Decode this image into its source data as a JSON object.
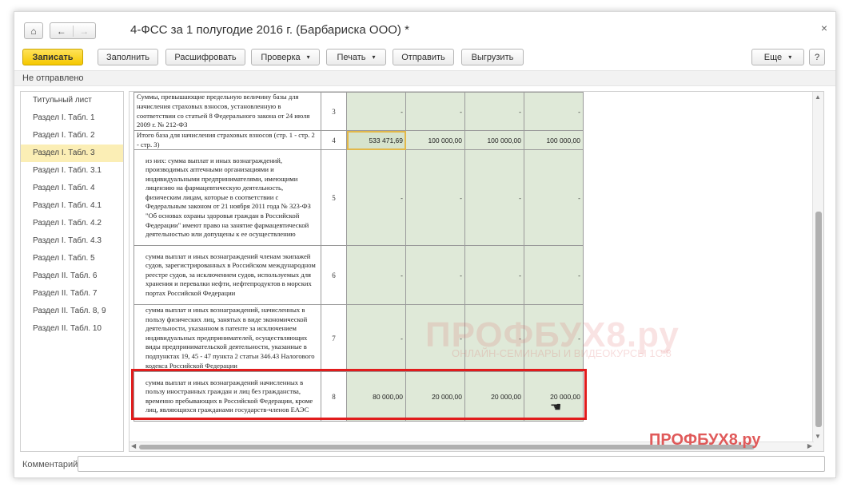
{
  "window": {
    "title": "4-ФСС за 1 полугодие 2016 г. (Барбариска ООО) *",
    "close_glyph": "×",
    "home_glyph": "⌂",
    "back_glyph": "←",
    "forward_glyph": "→"
  },
  "toolbar": {
    "save": "Записать",
    "fill": "Заполнить",
    "decode": "Расшифровать",
    "check": "Проверка",
    "print": "Печать",
    "send": "Отправить",
    "upload": "Выгрузить",
    "more": "Еще",
    "help": "?",
    "dropdown_glyph": "▾"
  },
  "status": "Не отправлено",
  "sidebar": {
    "items": [
      {
        "label": "Титульный лист"
      },
      {
        "label": "Раздел I. Табл. 1"
      },
      {
        "label": "Раздел I. Табл. 2"
      },
      {
        "label": "Раздел I. Табл. 3",
        "active": true
      },
      {
        "label": "Раздел I. Табл. 3.1"
      },
      {
        "label": "Раздел I. Табл. 4"
      },
      {
        "label": "Раздел I. Табл. 4.1"
      },
      {
        "label": "Раздел I. Табл. 4.2"
      },
      {
        "label": "Раздел I. Табл. 4.3"
      },
      {
        "label": "Раздел I. Табл. 5"
      },
      {
        "label": "Раздел II. Табл. 6"
      },
      {
        "label": "Раздел II. Табл. 7"
      },
      {
        "label": "Раздел II. Табл. 8, 9"
      },
      {
        "label": "Раздел II. Табл. 10"
      }
    ]
  },
  "table": {
    "rows": [
      {
        "desc": "Суммы, превышающие предельную величину базы для начисления страховых взносов, установленную в соответствии со статьей 8 Федерального закона от 24 июля 2009 г. № 212-ФЗ",
        "code": "3",
        "values": [
          "-",
          "-",
          "-",
          "-"
        ]
      },
      {
        "desc": "Итого база для начисления страховых взносов (стр. 1 - стр. 2 - стр. 3)",
        "code": "4",
        "values": [
          "533 471,69",
          "100 000,00",
          "100 000,00",
          "100 000,00"
        ]
      },
      {
        "desc": "из них: сумма выплат и иных вознаграждений, производимых аптечными организациями и индивидуальными предпринимателями, имеющими лицензию на фармацевтическую деятельность, физическим лицам, которые в соответствии с Федеральным законом от 21 ноября 2011 года № 323-ФЗ \"Об основах охраны здоровья граждан в Российской Федерации\" имеют право на занятие фармацевтической деятельностью или допущены к ее осуществлению",
        "code": "5",
        "values": [
          "-",
          "-",
          "-",
          "-"
        ]
      },
      {
        "desc": "сумма выплат и иных вознаграждений членам экипажей судов, зарегистрированных в Российском международном реестре судов, за исключением судов, используемых для хранения и перевалки нефти, нефтепродуктов в морских портах Российской Федерации",
        "code": "6",
        "values": [
          "-",
          "-",
          "-",
          "-"
        ]
      },
      {
        "desc": "сумма выплат и иных вознаграждений, начисленных в пользу физических лиц, занятых в виде экономической деятельности, указанном в патенте за исключением индивидуальных предпринимателей, осуществляющих виды предпринимательской деятельности, указанные в подпунктах 19, 45 - 47 пункта 2 статьи 346.43 Налогового кодекса Российской Федерации",
        "code": "7",
        "values": [
          "-",
          "-",
          "-",
          "-"
        ]
      },
      {
        "desc": "сумма выплат и иных вознаграждений начисленных в пользу иностранных граждан и лиц без гражданства, временно пребывающих в Российской Федерации, кроме лиц, являющихся гражданами государств-членов ЕАЭС",
        "code": "8",
        "values": [
          "80 000,00",
          "20 000,00",
          "20 000,00",
          "20 000,00"
        ]
      }
    ]
  },
  "watermark": {
    "main": "ПРОФБУХ8.ру",
    "sub": "ОНЛАЙН-СЕМИНАРЫ И ВИДЕОКУРСЫ 1С:8",
    "logo": "ПРОФБУХ8.ру"
  },
  "comment": {
    "label": "Комментарий:",
    "value": ""
  }
}
